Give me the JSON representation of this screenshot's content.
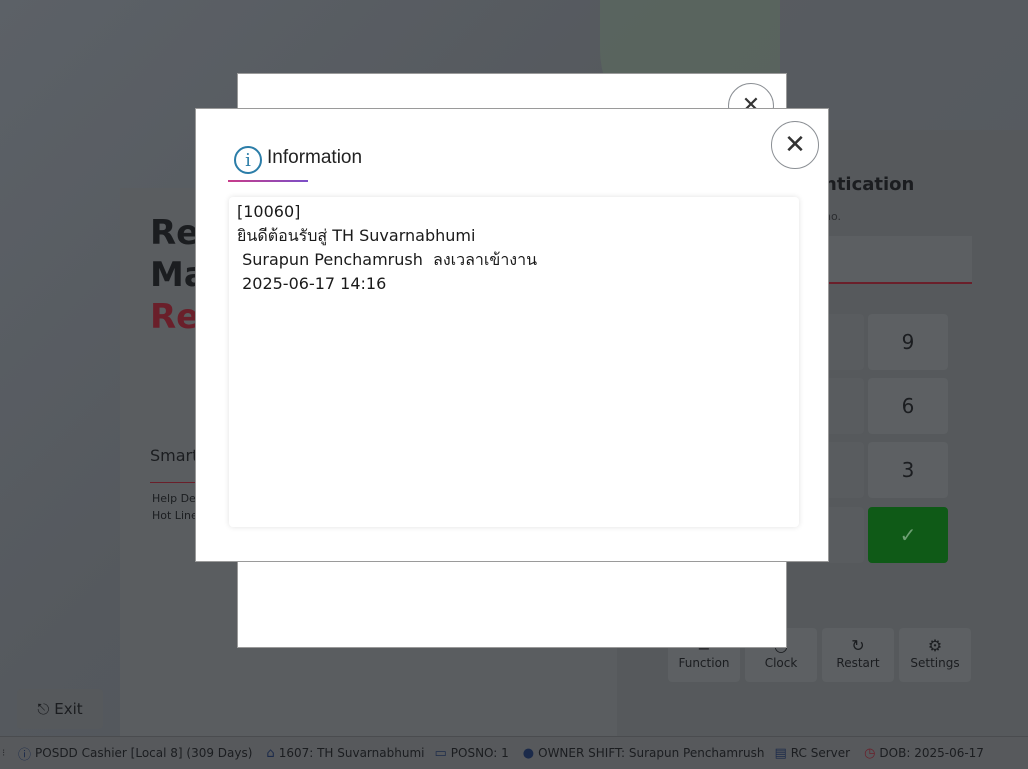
{
  "background": {
    "title_line1": "Re",
    "title_line2": "Ma",
    "title_line3": "Re",
    "smart_label": "Smart",
    "help_desk": "Help De",
    "hot_line": "Hot Line",
    "auth_title": "ntication",
    "auth_sub": "no.",
    "keypad": [
      "9",
      "6",
      "3"
    ],
    "function_buttons": [
      {
        "label": "Function",
        "icon": "function-icon",
        "glyph": "≡"
      },
      {
        "label": "Clock",
        "icon": "clock-icon",
        "glyph": "○"
      },
      {
        "label": "Restart",
        "icon": "restart-icon",
        "glyph": "↻"
      },
      {
        "label": "Settings",
        "icon": "settings-icon",
        "glyph": "⚙"
      }
    ],
    "exit_label": "Exit"
  },
  "status_bar": {
    "app": "POSDD Cashier [Local 8] (309 Days)",
    "store": "1607: TH Suvarnabhumi",
    "posno": "POSNO: 1",
    "shift": "OWNER SHIFT: Surapun Penchamrush",
    "server": "RC Server",
    "dob": "DOB: 2025-06-17"
  },
  "dialog": {
    "title": "Information",
    "close_glyph": "✕",
    "message_lines": [
      "[10060]",
      "ยินดีต้อนรับสู่ TH Suvarnabhumi",
      " Surapun Penchamrush  ลงเวลาเข้างาน",
      " 2025-06-17 14:16"
    ]
  },
  "colors": {
    "accent": "#2b7da8",
    "ok_button": "#0f5a17",
    "brand_red": "#6a1f2a"
  }
}
